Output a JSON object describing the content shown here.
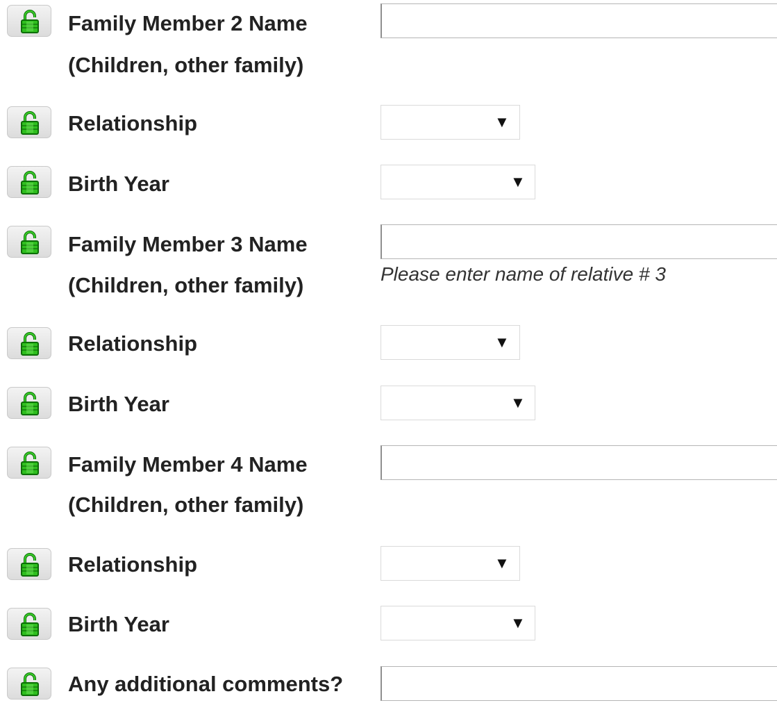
{
  "form": {
    "rows": [
      {
        "line1": "Family Member 2 Name",
        "line2": "(Children, other family)",
        "value": ""
      },
      {
        "label": "Relationship",
        "value": ""
      },
      {
        "label": "Birth Year",
        "value": ""
      },
      {
        "line1": "Family Member 3 Name",
        "line2": "(Children, other family)",
        "value": "",
        "hint": "Please enter name of relative # 3"
      },
      {
        "label": "Relationship",
        "value": ""
      },
      {
        "label": "Birth Year",
        "value": ""
      },
      {
        "line1": "Family Member 4 Name",
        "line2": "(Children, other family)",
        "value": ""
      },
      {
        "label": "Relationship",
        "value": ""
      },
      {
        "label": "Birth Year",
        "value": ""
      },
      {
        "label": "Any additional comments?",
        "value": ""
      }
    ],
    "dropdown_arrow": "▼"
  },
  "icons": {
    "row_icon": "open-padlock-icon",
    "lock_color": "#2fbf1e",
    "lock_outline": "#0d6e08"
  }
}
